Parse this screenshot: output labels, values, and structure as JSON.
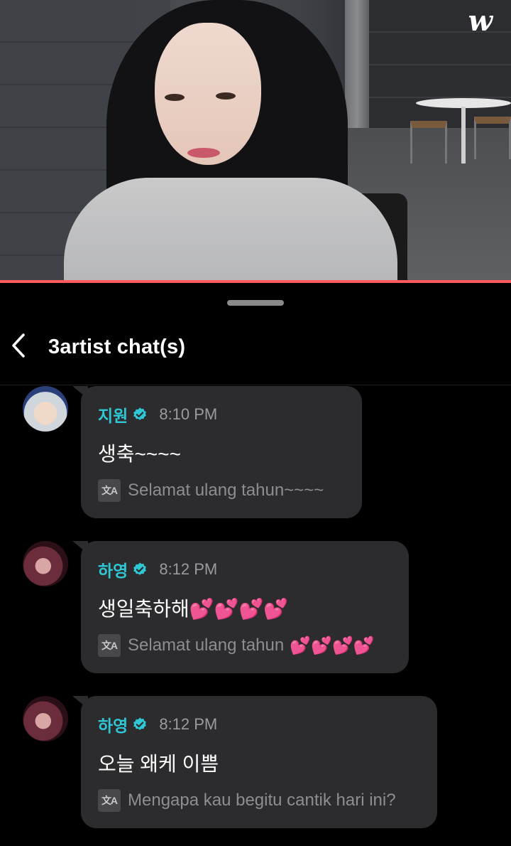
{
  "app": {
    "logo": "w"
  },
  "video": {
    "progress_percent": 100
  },
  "header": {
    "title": "3artist chat(s)"
  },
  "messages": [
    {
      "author": "지원",
      "time": "8:10 PM",
      "text": "생축~~~~",
      "translation": "Selamat ulang tahun~~~~",
      "avatar": "avatar-jiwon"
    },
    {
      "author": "하영",
      "time": "8:12 PM",
      "text": "생일축하해",
      "text_emoji": "💕💕💕💕",
      "translation": "Selamat ulang tahun",
      "translation_emoji": "💕💕💕💕",
      "avatar": "avatar-hayoung"
    },
    {
      "author": "하영",
      "time": "8:12 PM",
      "text": "오늘 왜케 이쁨",
      "translation": "Mengapa kau begitu cantik hari ini?",
      "avatar": "avatar-hayoung"
    }
  ],
  "icons": {
    "back": "chevron-left-icon",
    "verified": "verified-badge-icon",
    "translate": "translate-icon"
  },
  "colors": {
    "accent": "#2ec7d3",
    "progress": "#ff5a5f",
    "bubble": "#2c2c2e",
    "background": "#000000"
  }
}
